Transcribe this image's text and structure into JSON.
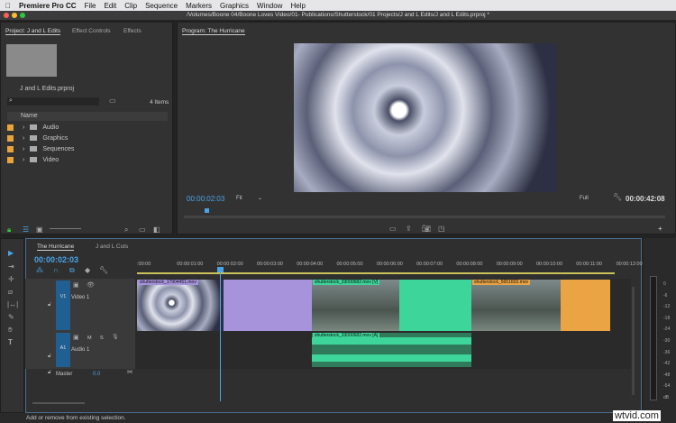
{
  "menubar": {
    "app": "Premiere Pro CC",
    "items": [
      "File",
      "Edit",
      "Clip",
      "Sequence",
      "Markers",
      "Graphics",
      "Window",
      "Help"
    ]
  },
  "window": {
    "title": "/Volumes/Boone 04/Boone Loves Video/01- Publications/Shutterstock/01 Projects/J and L Edits/J and L Edits.prproj *"
  },
  "project": {
    "tabs": [
      "Project: J and L Edits",
      "Effect Controls",
      "Effects"
    ],
    "file": "J and L Edits.prproj",
    "count": "4 Items",
    "column": "Name",
    "bins": [
      "Audio",
      "Graphics",
      "Sequences",
      "Video"
    ]
  },
  "program": {
    "tab": "Program: The Hurricane",
    "timecode": "00:00:02:03",
    "fit": "Fit",
    "quality": "Full",
    "duration": "00:00:42:08"
  },
  "timeline": {
    "tabs": [
      "The Hurricane",
      "J and L Cuts"
    ],
    "timecode": "00:00:02:03",
    "ruler": [
      ":00:00",
      "00:00:01:00",
      "00:00:02:00",
      "00:00:03:00",
      "00:00:04:00",
      "00:00:05:00",
      "00:00:06:00",
      "00:00:07:00",
      "00:00:08:00",
      "00:00:09:00",
      "00:00:10:00",
      "00:00:11:00",
      "00:00:12:00"
    ],
    "tracks": {
      "v1": "V1",
      "v1_name": "Video 1",
      "a1": "A1",
      "a1_name": "Audio 1",
      "m": "M",
      "s": "S",
      "master": "Master",
      "master_val": "0.0"
    },
    "clips": [
      "shutterstock_17904451.mov",
      "shutterstock_33000682.mov [V]",
      "shutterstock_5651603.mov"
    ],
    "audio_clip": "shutterstock_33000682.mov [A]"
  },
  "meter": [
    "0",
    "-6",
    "-12",
    "-18",
    "-24",
    "-30",
    "-36",
    "-42",
    "-48",
    "-54",
    "dB"
  ],
  "status": "Add or remove from existing selection.",
  "watermark": "wtvid.com",
  "colors": {
    "accent": "#4aa3e6",
    "purple": "#a792dc",
    "green": "#3dd59a",
    "orange": "#eba444",
    "track": "#1f5f92"
  }
}
